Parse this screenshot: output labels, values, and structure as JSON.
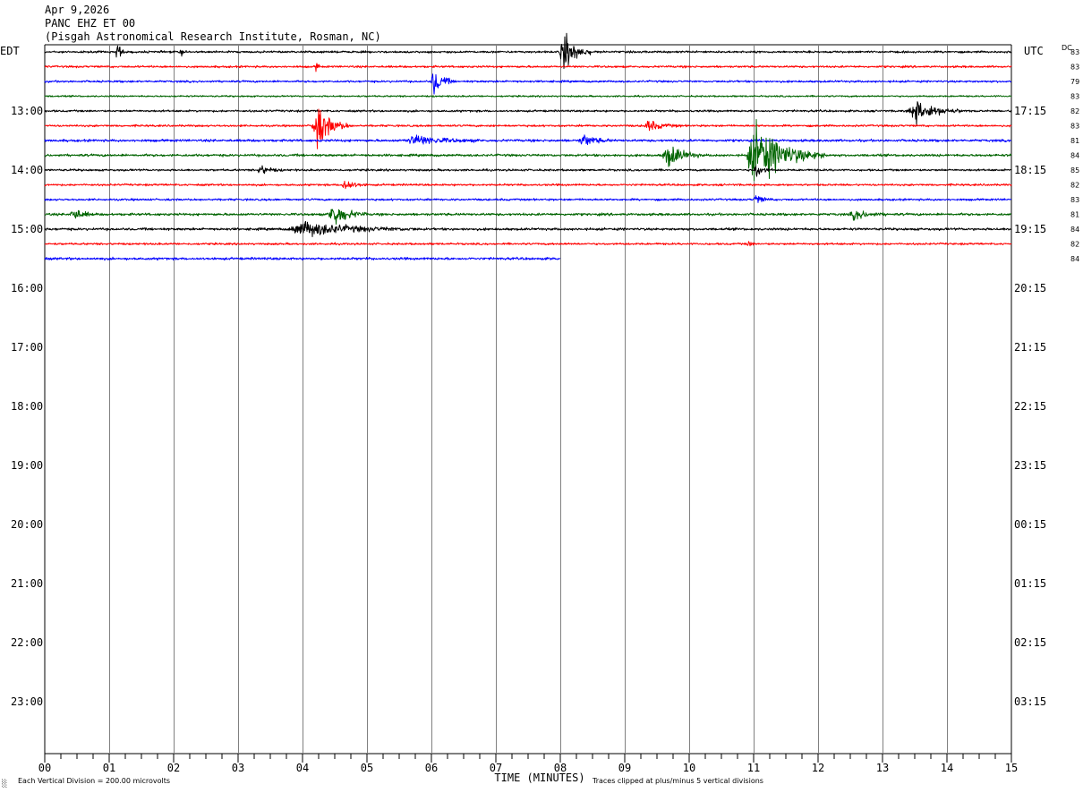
{
  "header": {
    "date": "Apr 9,2026",
    "station": "PANC EHZ ET 00",
    "location": "(Pisgah Astronomical Research Institute, Rosman, NC)"
  },
  "labels": {
    "left_timezone": "EDT",
    "right_timezone": "UTC",
    "dc_header": "DC",
    "xlabel": "TIME (MINUTES)",
    "scale_note": "Each Vertical Division =  200.00 microvolts",
    "clip_note": "Traces clipped at plus/minus 5 vertical divisions",
    "corner_mark": "░"
  },
  "colors": {
    "trace_cycle": [
      "#000000",
      "#ff0000",
      "#0000ff",
      "#006400"
    ],
    "grid": "#808080",
    "frame": "#000000"
  },
  "chart_data": {
    "type": "line",
    "subtype": "helicorder",
    "x_range": [
      0,
      15
    ],
    "x_ticks": [
      "00",
      "01",
      "02",
      "03",
      "04",
      "05",
      "06",
      "07",
      "08",
      "09",
      "10",
      "11",
      "12",
      "13",
      "14",
      "15"
    ],
    "minor_ticks_per_minute": 4,
    "rows_total": 48,
    "minutes_per_row": 15,
    "left_hour_labels": [
      "13:00",
      "14:00",
      "15:00",
      "16:00",
      "17:00",
      "18:00",
      "19:00",
      "20:00",
      "21:00",
      "22:00",
      "23:00"
    ],
    "right_hour_labels": [
      "17:15",
      "18:15",
      "19:15",
      "20:15",
      "21:15",
      "22:15",
      "23:15",
      "00:15",
      "01:15",
      "02:15",
      "03:15"
    ],
    "hour_label_first_row": 4,
    "rows_per_label": 4,
    "dc_offsets": [
      "83",
      "83",
      "79",
      "83",
      "82",
      "83",
      "81",
      "84",
      "85",
      "82",
      "83",
      "81",
      "84",
      "82",
      "84"
    ],
    "traces": [
      {
        "row": 0,
        "color": "#000000",
        "end_minute": 15,
        "noise": 0.5,
        "events": [
          {
            "t": 1.1,
            "amp": 10,
            "dur": 0.15
          },
          {
            "t": 2.1,
            "amp": 4,
            "dur": 0.1
          },
          {
            "t": 8.0,
            "amp": 16,
            "dur": 0.5
          }
        ]
      },
      {
        "row": 1,
        "color": "#ff0000",
        "end_minute": 15,
        "noise": 0.5,
        "events": [
          {
            "t": 4.2,
            "amp": 5,
            "dur": 0.08
          }
        ]
      },
      {
        "row": 2,
        "color": "#0000ff",
        "end_minute": 15,
        "noise": 0.5,
        "events": [
          {
            "t": 6.0,
            "amp": 12,
            "dur": 0.35
          }
        ]
      },
      {
        "row": 3,
        "color": "#006400",
        "end_minute": 15,
        "noise": 0.4,
        "events": []
      },
      {
        "row": 4,
        "color": "#000000",
        "end_minute": 15,
        "noise": 0.5,
        "events": [
          {
            "t": 13.4,
            "amp": 9,
            "dur": 0.9
          }
        ]
      },
      {
        "row": 5,
        "color": "#ff0000",
        "end_minute": 15,
        "noise": 0.5,
        "events": [
          {
            "t": 4.15,
            "amp": 18,
            "dur": 0.6
          },
          {
            "t": 9.3,
            "amp": 4,
            "dur": 0.6
          }
        ]
      },
      {
        "row": 6,
        "color": "#0000ff",
        "end_minute": 15,
        "noise": 0.6,
        "events": [
          {
            "t": 5.6,
            "amp": 4,
            "dur": 1.2
          },
          {
            "t": 8.3,
            "amp": 5,
            "dur": 0.5
          }
        ]
      },
      {
        "row": 7,
        "color": "#006400",
        "end_minute": 15,
        "noise": 0.6,
        "events": [
          {
            "t": 9.6,
            "amp": 10,
            "dur": 0.6
          },
          {
            "t": 10.9,
            "amp": 26,
            "dur": 1.2
          }
        ]
      },
      {
        "row": 8,
        "color": "#000000",
        "end_minute": 15,
        "noise": 0.5,
        "events": [
          {
            "t": 3.3,
            "amp": 4,
            "dur": 0.4
          },
          {
            "t": 11.0,
            "amp": 6,
            "dur": 0.3
          }
        ]
      },
      {
        "row": 9,
        "color": "#ff0000",
        "end_minute": 15,
        "noise": 0.5,
        "events": [
          {
            "t": 4.6,
            "amp": 5,
            "dur": 0.4
          }
        ]
      },
      {
        "row": 10,
        "color": "#0000ff",
        "end_minute": 15,
        "noise": 0.5,
        "events": [
          {
            "t": 11.0,
            "amp": 4,
            "dur": 0.3
          }
        ]
      },
      {
        "row": 11,
        "color": "#006400",
        "end_minute": 15,
        "noise": 0.6,
        "events": [
          {
            "t": 0.4,
            "amp": 5,
            "dur": 0.4
          },
          {
            "t": 4.4,
            "amp": 10,
            "dur": 0.6
          },
          {
            "t": 12.5,
            "amp": 4,
            "dur": 0.6
          }
        ]
      },
      {
        "row": 12,
        "color": "#000000",
        "end_minute": 15,
        "noise": 0.6,
        "events": [
          {
            "t": 3.8,
            "amp": 6,
            "dur": 2.0
          }
        ]
      },
      {
        "row": 13,
        "color": "#ff0000",
        "end_minute": 15,
        "noise": 0.5,
        "events": [
          {
            "t": 10.9,
            "amp": 5,
            "dur": 0.1
          }
        ]
      },
      {
        "row": 14,
        "color": "#0000ff",
        "end_minute": 8.0,
        "noise": 0.6,
        "events": []
      }
    ]
  }
}
